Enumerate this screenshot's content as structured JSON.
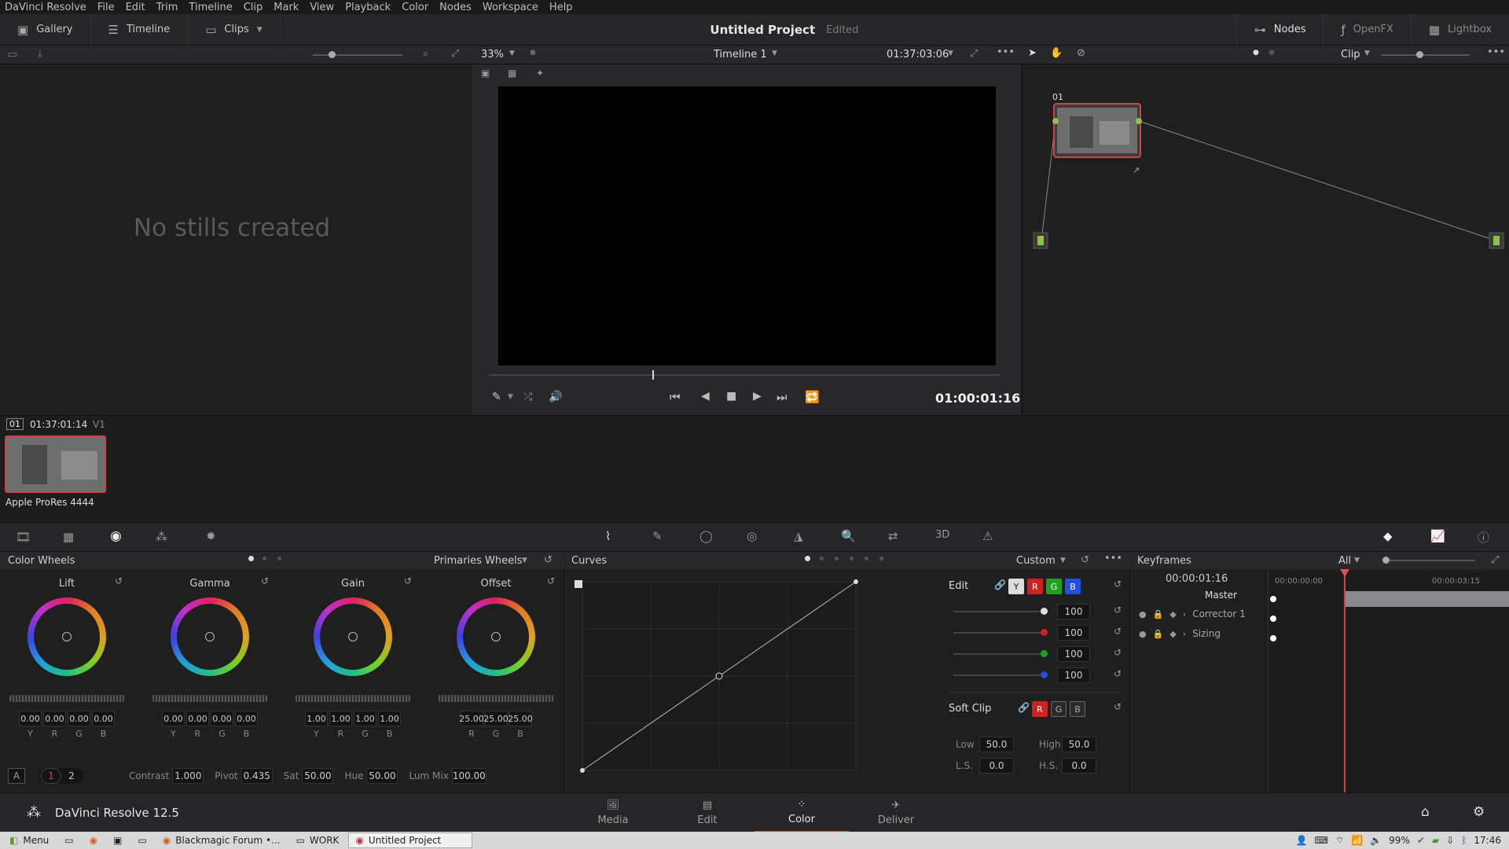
{
  "menubar": {
    "items": [
      "DaVinci Resolve",
      "File",
      "Edit",
      "Trim",
      "Timeline",
      "Clip",
      "Mark",
      "View",
      "Playback",
      "Color",
      "Nodes",
      "Workspace",
      "Help"
    ]
  },
  "toolbar": {
    "gallery": "Gallery",
    "timeline": "Timeline",
    "clips": "Clips",
    "project_title": "Untitled Project",
    "edited": "Edited",
    "nodes": "Nodes",
    "openfx": "OpenFX",
    "lightbox": "Lightbox"
  },
  "viewer": {
    "zoom": "33%",
    "timeline_name": "Timeline 1",
    "source_tc": "01:37:03:06",
    "playhead_fraction": 0.32,
    "timecode": "01:00:01:16",
    "clip_mode": "Clip"
  },
  "gallery": {
    "empty_text": "No stills created"
  },
  "nodes": {
    "node_label": "01"
  },
  "clip": {
    "index": "01",
    "timecode": "01:37:01:14",
    "track": "V1",
    "codec": "Apple ProRes 4444"
  },
  "color_wheels": {
    "title": "Color Wheels",
    "mode": "Primaries Wheels",
    "wheels": [
      {
        "name": "Lift",
        "values": [
          "0.00",
          "0.00",
          "0.00",
          "0.00"
        ],
        "channels": [
          "Y",
          "R",
          "G",
          "B"
        ]
      },
      {
        "name": "Gamma",
        "values": [
          "0.00",
          "0.00",
          "0.00",
          "0.00"
        ],
        "channels": [
          "Y",
          "R",
          "G",
          "B"
        ]
      },
      {
        "name": "Gain",
        "values": [
          "1.00",
          "1.00",
          "1.00",
          "1.00"
        ],
        "channels": [
          "Y",
          "R",
          "G",
          "B"
        ]
      },
      {
        "name": "Offset",
        "values": [
          "25.00",
          "25.00",
          "25.00"
        ],
        "channels": [
          "R",
          "G",
          "B"
        ]
      }
    ],
    "footer": {
      "a": "A",
      "page1": "1",
      "page2": "2",
      "contrast_label": "Contrast",
      "contrast": "1.000",
      "pivot_label": "Pivot",
      "pivot": "0.435",
      "sat_label": "Sat",
      "sat": "50.00",
      "hue_label": "Hue",
      "hue": "50.00",
      "lummix_label": "Lum Mix",
      "lummix": "100.00"
    }
  },
  "curves": {
    "title": "Curves",
    "mode": "Custom",
    "edit_label": "Edit",
    "channel_buttons": [
      "Y",
      "R",
      "G",
      "B"
    ],
    "intensity": [
      "100",
      "100",
      "100",
      "100"
    ],
    "soft_clip_label": "Soft Clip",
    "soft_clip_buttons": [
      "R",
      "G",
      "B"
    ],
    "low_label": "Low",
    "low": "50.0",
    "high_label": "High",
    "high": "50.0",
    "ls_label": "L.S.",
    "ls": "0.0",
    "hs_label": "H.S.",
    "hs": "0.0"
  },
  "keyframes": {
    "title": "Keyframes",
    "filter": "All",
    "current_tc": "00:00:01:16",
    "ruler_start": "00:00:00:00",
    "ruler_end": "00:00:03:15",
    "tracks": [
      "Master",
      "Corrector 1",
      "Sizing"
    ]
  },
  "app": {
    "name": "DaVinci Resolve 12.5"
  },
  "pages": [
    "Media",
    "Edit",
    "Color",
    "Deliver"
  ],
  "active_page": "Color",
  "taskbar": {
    "menu": "Menu",
    "items": [
      "Blackmagic Forum •...",
      "WORK",
      "Untitled Project"
    ],
    "battery": "99%",
    "clock": "17:46"
  },
  "colors": {
    "accent_red": "#e04040",
    "node_green": "#8bc34a",
    "wheel_bg": "#1f1f20"
  }
}
